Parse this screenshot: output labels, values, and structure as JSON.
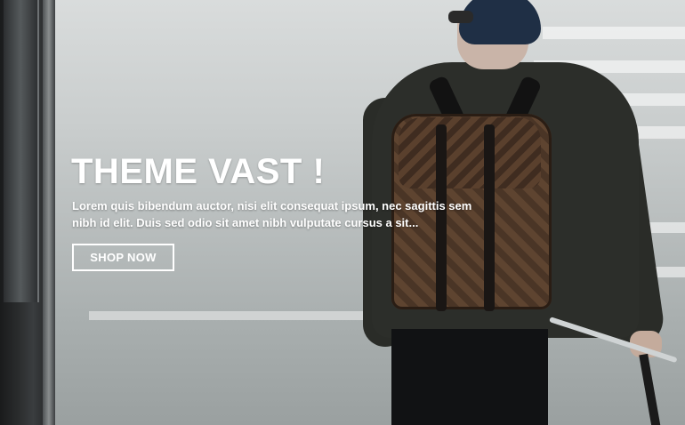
{
  "hero": {
    "title": "THEME VAST !",
    "description": "Lorem quis bibendum auctor, nisi elit consequat ipsum, nec sagittis sem nibh id elit. Duis sed odio sit amet nibh vulputate cursus a sit...",
    "cta_label": "SHOP NOW",
    "text_color": "#ffffff",
    "button_border_color": "#ffffff"
  }
}
